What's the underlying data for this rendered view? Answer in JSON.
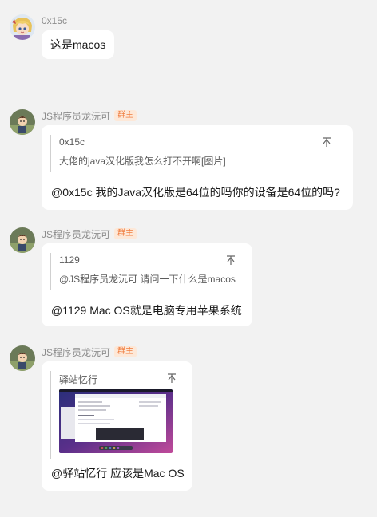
{
  "messages": [
    {
      "sender": "0x15c",
      "role": "",
      "avatar_icon": "anime-avatar-icon",
      "text": "这是macos"
    },
    {
      "sender": "JS程序员龙沅可",
      "role": "群主",
      "avatar_icon": "character-avatar-icon",
      "quote_author": "0x15c",
      "quote_text": "大佬的java汉化版我怎么打不开啊[图片]",
      "text": "@0x15c 我的Java汉化版是64位的吗你的设备是64位的吗?"
    },
    {
      "sender": "JS程序员龙沅可",
      "role": "群主",
      "avatar_icon": "character-avatar-icon",
      "quote_author": "1129",
      "quote_text": "@JS程序员龙沅可 请问一下什么是macos",
      "text": "@1129 Mac OS就是电脑专用苹果系统"
    },
    {
      "sender": "JS程序员龙沅可",
      "role": "群主",
      "avatar_icon": "character-avatar-icon",
      "quote_author": "驿站忆行",
      "quote_image": "macos-screenshot-thumbnail",
      "text": "@驿站忆行 应该是Mac OS"
    }
  ],
  "icons": {
    "pin": "pin-icon"
  },
  "colors": {
    "background": "#f2f2f2",
    "bubble": "#ffffff",
    "badge_text": "#f07c3e",
    "badge_bg": "#fde8d8"
  }
}
